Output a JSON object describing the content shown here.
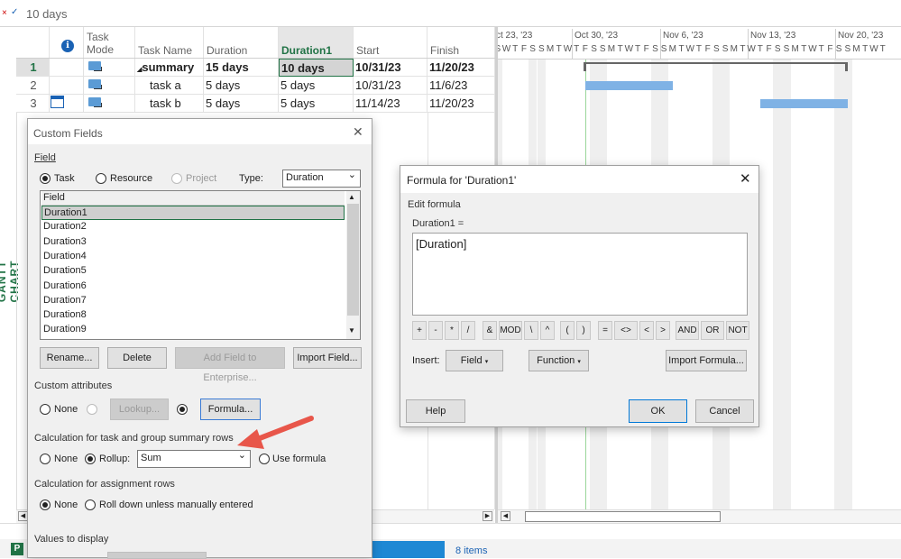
{
  "formula_bar": {
    "cancel": "×",
    "enter": "✓",
    "value": "10 days"
  },
  "side_label": "GANTT CHART",
  "grid": {
    "headers": {
      "info": "ℹ",
      "task_mode": "Task Mode",
      "task_name": "Task Name",
      "duration": "Duration",
      "duration1": "Duration1",
      "start": "Start",
      "finish": "Finish"
    },
    "rows": [
      {
        "id": "1",
        "name": "summary",
        "duration": "15 days",
        "duration1": "10 days",
        "start": "10/31/23",
        "finish": "11/20/23"
      },
      {
        "id": "2",
        "name": "task a",
        "duration": "5 days",
        "duration1": "5 days",
        "start": "10/31/23",
        "finish": "11/6/23"
      },
      {
        "id": "3",
        "name": "task b",
        "duration": "5 days",
        "duration1": "5 days",
        "start": "11/14/23",
        "finish": "11/20/23"
      }
    ]
  },
  "timeline": {
    "weeks": [
      "ct 23, '23",
      "Oct 30, '23",
      "Nov 6, '23",
      "Nov 13, '23",
      "Nov 20, '23"
    ],
    "days": [
      "S",
      "W",
      "T",
      "F",
      "S",
      "S",
      "M",
      "T",
      "W",
      "T",
      "F",
      "S",
      "S",
      "M",
      "T",
      "W",
      "T",
      "F",
      "S",
      "S",
      "M",
      "T",
      "W",
      "T",
      "F",
      "S",
      "S",
      "M",
      "T",
      "W",
      "T",
      "F",
      "S",
      "S",
      "M",
      "T",
      "W",
      "T",
      "F",
      "S",
      "S",
      "M",
      "T",
      "W",
      "T"
    ]
  },
  "custom_fields": {
    "title": "Custom Fields",
    "close": "✕",
    "field_label": "Field",
    "task": "Task",
    "resource": "Resource",
    "project": "Project",
    "type_label": "Type:",
    "type_value": "Duration",
    "list_header": "Field",
    "list": [
      "Duration1",
      "Duration2",
      "Duration3",
      "Duration4",
      "Duration5",
      "Duration6",
      "Duration7",
      "Duration8",
      "Duration9"
    ],
    "rename": "Rename...",
    "delete": "Delete",
    "add_enterprise": "Add Field to Enterprise...",
    "import_field": "Import Field...",
    "custom_attributes": "Custom attributes",
    "none": "None",
    "lookup": "Lookup...",
    "formula": "Formula...",
    "calc_summary": "Calculation for task and group summary rows",
    "none2": "None",
    "rollup": "Rollup:",
    "rollup_value": "Sum",
    "use_formula": "Use formula",
    "calc_assignment": "Calculation for assignment rows",
    "none3": "None",
    "roll_down": "Roll down unless manually entered",
    "values_display": "Values to display"
  },
  "formula": {
    "title": "Formula for 'Duration1'",
    "close": "✕",
    "edit_label": "Edit formula",
    "field_eq": "Duration1 =",
    "text": "[Duration]",
    "ops1": [
      "+",
      "-",
      "*",
      "/"
    ],
    "ops2": [
      "&",
      "MOD",
      "\\",
      "^"
    ],
    "ops3": [
      "(",
      ")"
    ],
    "ops4": [
      "=",
      "<>",
      "<",
      ">"
    ],
    "ops5": [
      "AND",
      "OR",
      "NOT"
    ],
    "insert_label": "Insert:",
    "field_btn": "Field",
    "function_btn": "Function",
    "import_formula": "Import Formula...",
    "help": "Help",
    "ok": "OK",
    "cancel": "Cancel"
  },
  "taskbar": {
    "items": "8 items"
  },
  "colors": {
    "accent": "#217346",
    "bar": "#7fb2e5",
    "arrow": "#e8564a"
  }
}
